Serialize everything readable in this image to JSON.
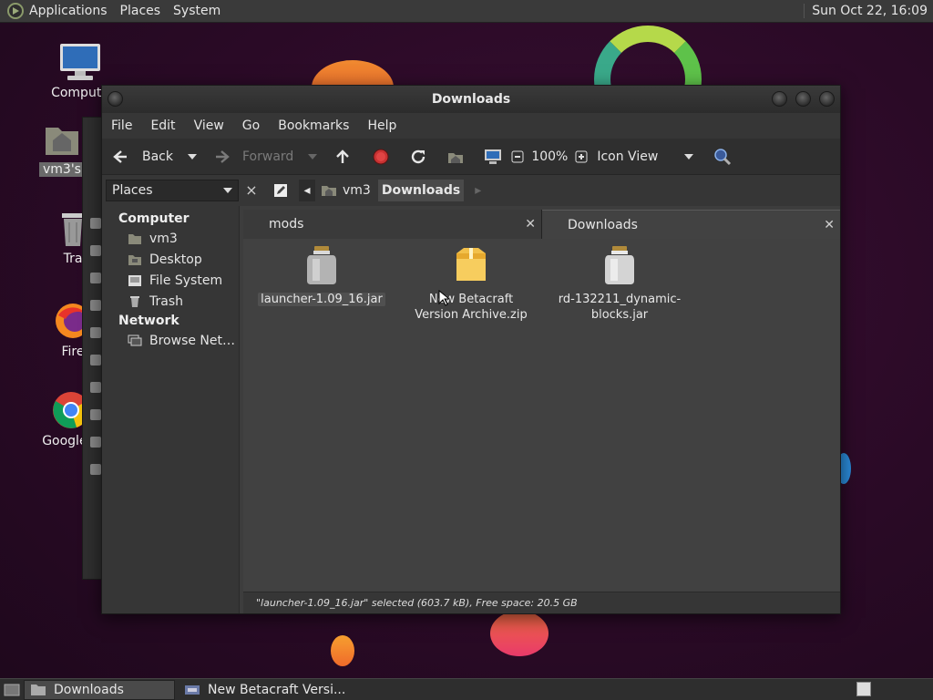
{
  "panel": {
    "menus": [
      "Applications",
      "Places",
      "System"
    ],
    "clock": "Sun Oct 22, 16:09"
  },
  "desktop": {
    "icons": [
      {
        "label": "Compute",
        "icon": "computer-icon"
      },
      {
        "label": "vm3's",
        "icon": "home-folder-icon"
      },
      {
        "label": "Tra",
        "icon": "trash-icon"
      },
      {
        "label": "Fire",
        "icon": "firefox-icon"
      },
      {
        "label": "Google C",
        "icon": "chrome-icon"
      }
    ]
  },
  "window": {
    "title": "Downloads",
    "menus": [
      "File",
      "Edit",
      "View",
      "Go",
      "Bookmarks",
      "Help"
    ],
    "toolbar": {
      "back": "Back",
      "forward": "Forward",
      "zoom": "100%",
      "view_mode": "Icon View"
    },
    "location": {
      "places_label": "Places",
      "crumbs": [
        "vm3",
        "Downloads"
      ]
    },
    "sidebar": {
      "computer_header": "Computer",
      "computer_items": [
        "vm3",
        "Desktop",
        "File System",
        "Trash"
      ],
      "network_header": "Network",
      "network_items": [
        "Browse Net…"
      ]
    },
    "tabs": [
      "mods",
      "Downloads"
    ],
    "files": [
      {
        "name": "launcher-1.09_16.jar",
        "type": "jar",
        "selected": true
      },
      {
        "name": "New Betacraft Version Archive.zip",
        "type": "zip",
        "selected": false
      },
      {
        "name": "rd-132211_dynamic-blocks.jar",
        "type": "jar",
        "selected": false
      }
    ],
    "status": "\"launcher-1.09_16.jar\" selected (603.7 kB), Free space: 20.5 GB"
  },
  "taskbar": {
    "tasks": [
      "Downloads",
      "New Betacraft Versi..."
    ]
  },
  "colors": {
    "desktop_bg": "#2a0a26",
    "window_bg": "#3d3d3d",
    "accent_green": "#5ec24a"
  }
}
